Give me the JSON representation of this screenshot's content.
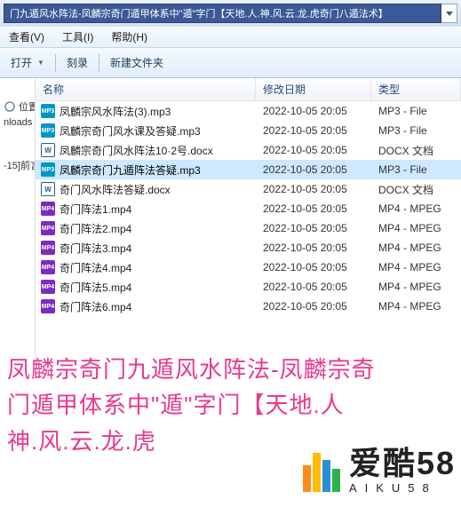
{
  "address": "门九遁风水阵法-凤麟宗奇门遁甲体系中\"遁\"字门【天地.人.神.风.云.龙.虎奇门八遁法术】",
  "menu": {
    "view": "查看(V)",
    "tools": "工具(I)",
    "help": "帮助(H)"
  },
  "toolbar": {
    "open": "打开",
    "burn": "刻录",
    "newfolder": "新建文件夹"
  },
  "sidebar": {
    "items": [
      {
        "label": "位置"
      },
      {
        "label": "nloads"
      },
      {
        "label": "-15]前言"
      }
    ]
  },
  "columns": {
    "name": "名称",
    "date": "修改日期",
    "type": "类型"
  },
  "files": [
    {
      "icon": "mp3",
      "name": "凤麟宗风水阵法(3).mp3",
      "date": "2022-10-05 20:05",
      "type": "MP3 - File",
      "selected": false
    },
    {
      "icon": "mp3",
      "name": "凤麟宗奇门风水课及答疑.mp3",
      "date": "2022-10-05 20:05",
      "type": "MP3 - File",
      "selected": false
    },
    {
      "icon": "docx",
      "name": "凤麟宗奇门风水阵法10·2号.docx",
      "date": "2022-10-05 20:05",
      "type": "DOCX 文档",
      "selected": false
    },
    {
      "icon": "mp3",
      "name": "凤麟宗奇门九遁阵法答疑.mp3",
      "date": "2022-10-05 20:05",
      "type": "MP3 - File",
      "selected": true
    },
    {
      "icon": "docx",
      "name": "奇门风水阵法答疑.docx",
      "date": "2022-10-05 20:05",
      "type": "DOCX 文档",
      "selected": false
    },
    {
      "icon": "mp4",
      "name": "奇门阵法1.mp4",
      "date": "2022-10-05 20:05",
      "type": "MP4 - MPEG",
      "selected": false
    },
    {
      "icon": "mp4",
      "name": "奇门阵法2.mp4",
      "date": "2022-10-05 20:05",
      "type": "MP4 - MPEG",
      "selected": false
    },
    {
      "icon": "mp4",
      "name": "奇门阵法3.mp4",
      "date": "2022-10-05 20:05",
      "type": "MP4 - MPEG",
      "selected": false
    },
    {
      "icon": "mp4",
      "name": "奇门阵法4.mp4",
      "date": "2022-10-05 20:05",
      "type": "MP4 - MPEG",
      "selected": false
    },
    {
      "icon": "mp4",
      "name": "奇门阵法5.mp4",
      "date": "2022-10-05 20:05",
      "type": "MP4 - MPEG",
      "selected": false
    },
    {
      "icon": "mp4",
      "name": "奇门阵法6.mp4",
      "date": "2022-10-05 20:05",
      "type": "MP4 - MPEG",
      "selected": false
    }
  ],
  "overlay": {
    "line1": "凤麟宗奇门九遁风水阵法-凤麟宗奇",
    "line2": "门遁甲体系中\"遁\"字门【天地.人",
    "line3": "神.风.云.龙.虎"
  },
  "watermark": {
    "cn": "爱酷58",
    "en": "AIKU58"
  }
}
